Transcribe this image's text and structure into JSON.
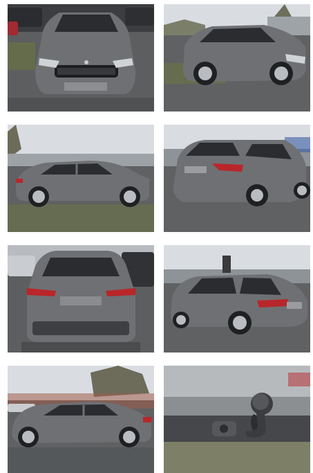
{
  "gallery": {
    "photos": [
      {
        "view": "front",
        "body_color": "#6f7073"
      },
      {
        "view": "front-three-quarter",
        "body_color": "#6f7073"
      },
      {
        "view": "side",
        "body_color": "#6f7073"
      },
      {
        "view": "rear-three-quarter",
        "body_color": "#6f7073"
      },
      {
        "view": "rear",
        "body_color": "#6f7073"
      },
      {
        "view": "rear-three-quarter-right",
        "body_color": "#6f7073"
      },
      {
        "view": "side-left",
        "body_color": "#6f7073"
      },
      {
        "view": "tow-hitch",
        "body_color": "#6f7073"
      }
    ]
  },
  "colors": {
    "sky": "#d9dde2",
    "asphalt": "#5c5e60",
    "grass": "#6e7a3c",
    "taillight": "#b8262a",
    "chrome": "#c9cbce",
    "tire": "#1f2022"
  }
}
